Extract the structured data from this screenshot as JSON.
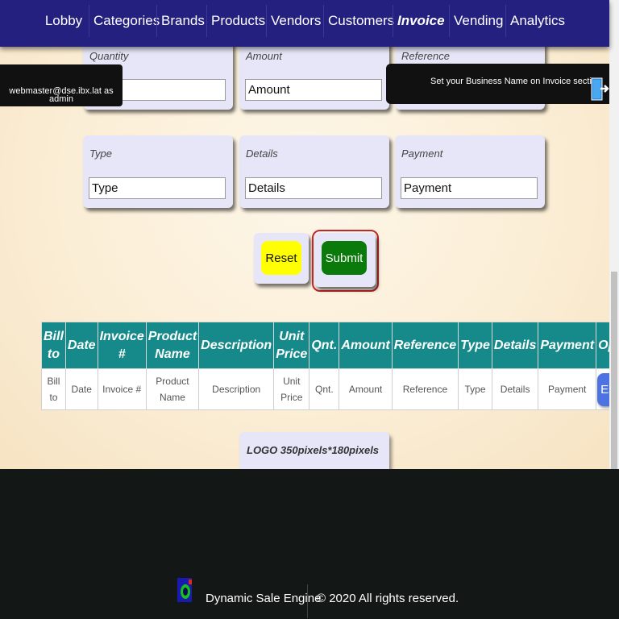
{
  "nav": {
    "items": [
      "Lobby",
      "Categories",
      "Brands",
      "Products",
      "Vendors",
      "Customers",
      "Invoice",
      "Vending",
      "Analytics"
    ],
    "active": "Invoice"
  },
  "user": {
    "email": "webmaster@dse.ibx.lat as",
    "role": "admin"
  },
  "banner": {
    "text": "Set your Business Name on Invoice section"
  },
  "form": {
    "quantity": {
      "label": "Quantity",
      "value": ""
    },
    "amount": {
      "label": "Amount",
      "value": "Amount"
    },
    "reference": {
      "label": "Reference",
      "value": ""
    },
    "type": {
      "label": "Type",
      "value": "Type"
    },
    "details": {
      "label": "Details",
      "value": "Details"
    },
    "payment": {
      "label": "Payment",
      "value": "Payment"
    }
  },
  "buttons": {
    "reset": "Reset",
    "submit": "Submit"
  },
  "table": {
    "headers": [
      [
        "Bill",
        "to"
      ],
      [
        "Date"
      ],
      [
        "Invoice",
        "#"
      ],
      [
        "Product",
        "Name"
      ],
      [
        "Description"
      ],
      [
        "Unit",
        "Price"
      ],
      [
        "Qnt."
      ],
      [
        "Amount"
      ],
      [
        "Reference"
      ],
      [
        "Type"
      ],
      [
        "Details"
      ],
      [
        "Payment"
      ],
      [
        "Options"
      ]
    ],
    "row": [
      [
        "Bill",
        "to"
      ],
      [
        "Date"
      ],
      [
        "Invoice #"
      ],
      [
        "Product",
        "Name"
      ],
      [
        "Description"
      ],
      [
        "Unit",
        "Price"
      ],
      [
        "Qnt."
      ],
      [
        "Amount"
      ],
      [
        "Reference"
      ],
      [
        "Type"
      ],
      [
        "Details"
      ],
      [
        "Payment"
      ]
    ],
    "option_button": "Espanol"
  },
  "logo_placeholder": "LOGO 350pixels*180pixels",
  "footer": {
    "brand": "Dynamic Sale Engine",
    "copyright": "© 2020 All rights reserved."
  },
  "colors": {
    "nav_bg": "#23207f",
    "table_header": "#168a8a",
    "reset_button": "#ffff00",
    "submit_button": "#0a7a0a",
    "espanol_button": "#4d73e3",
    "footer_bg": "#131715",
    "focus_ring": "#c0272d"
  },
  "icons": {
    "logout": "logout-door-icon",
    "footer_logo": "dse-logo-icon"
  }
}
